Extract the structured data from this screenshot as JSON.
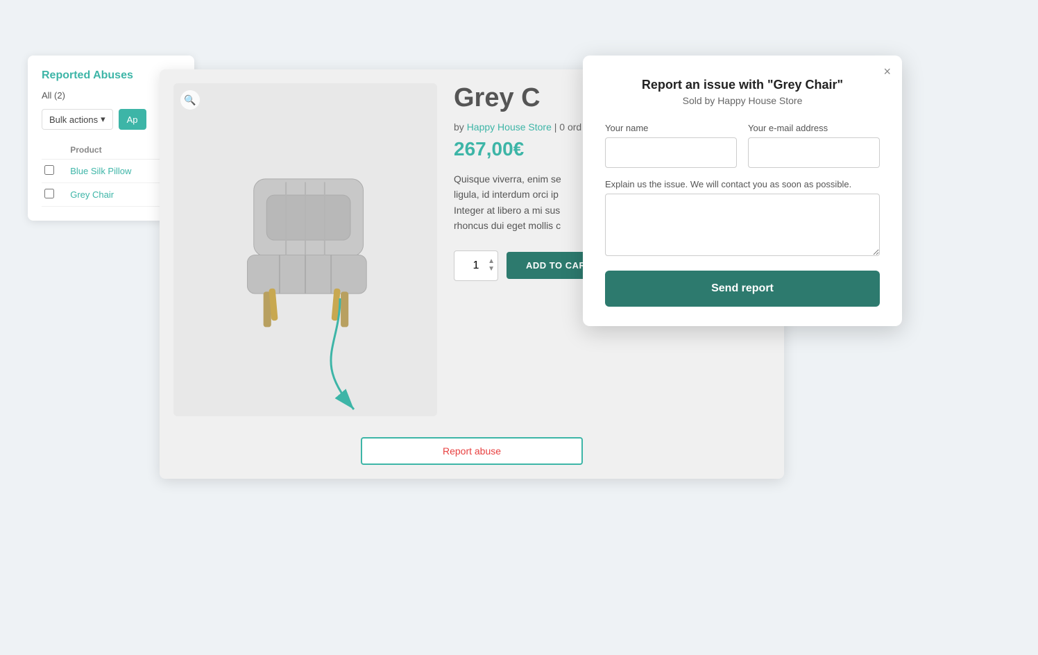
{
  "admin": {
    "title": "Reported Abuses",
    "count": "All (2)",
    "bulk_actions_label": "Bulk actions",
    "apply_label": "Ap",
    "table": {
      "header": "Product",
      "rows": [
        {
          "name": "Blue Silk Pillow"
        },
        {
          "name": "Grey Chair"
        }
      ]
    }
  },
  "product": {
    "title": "Grey C",
    "seller_prefix": "by",
    "seller_name": "Happy House Store",
    "seller_suffix": "| 0 ord",
    "price": "267,00€",
    "description_line1": "Quisque viverra, enim se",
    "description_line2": "ligula, id interdum orci ip",
    "description_line3": "Integer at libero a mi sus",
    "description_line4": "rhoncus dui eget mollis c",
    "quantity": "1",
    "add_to_cart_label": "ADD TO CART",
    "report_abuse_label": "Report abuse"
  },
  "modal": {
    "title": "Report an issue with \"Grey Chair\"",
    "subtitle": "Sold by Happy House Store",
    "name_label": "Your name",
    "email_label": "Your e-mail address",
    "explain_label": "Explain us the issue. We will contact you as soon as possible.",
    "send_label": "Send report",
    "close_label": "×"
  }
}
